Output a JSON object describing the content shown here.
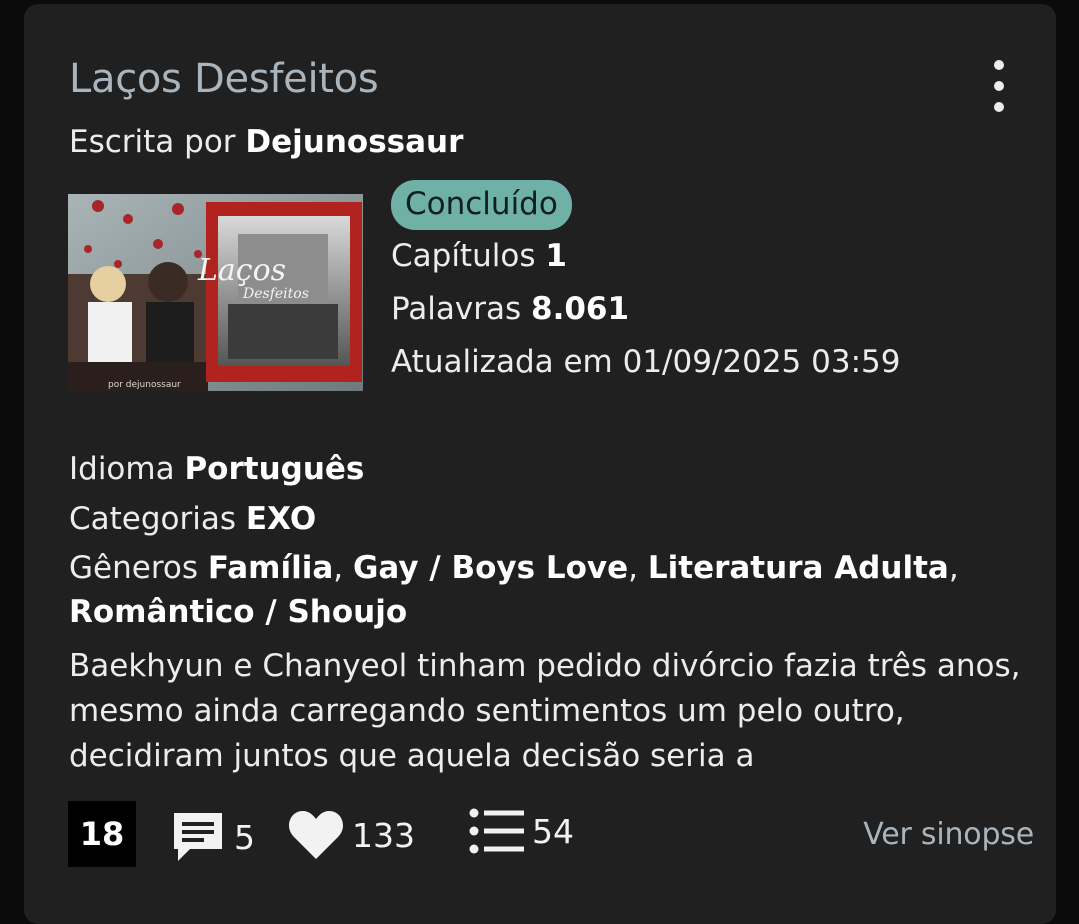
{
  "story": {
    "title": "Laços Desfeitos",
    "author_prefix": "Escrita por",
    "author": "Dejunossaur"
  },
  "cover": {
    "text_main": "Laços",
    "text_sub": "Desfeitos",
    "credit": "por dejunossaur"
  },
  "meta": {
    "status": "Concluído",
    "chapters_label": "Capítulos",
    "chapters": "1",
    "words_label": "Palavras",
    "words": "8.061",
    "updated": "Atualizada em 01/09/2025 03:59"
  },
  "info": {
    "language_label": "Idioma",
    "language": "Português",
    "categories_label": "Categorias",
    "categories": "EXO",
    "genres_label": "Gêneros",
    "genres": [
      "Família",
      "Gay / Boys Love",
      "Literatura Adulta",
      "Romântico / Shoujo"
    ]
  },
  "synopsis": "Baekhyun e Chanyeol tinham pedido divórcio fazia três anos, mesmo ainda carregando sentimentos um pelo outro, decidiram juntos que aquela decisão seria a",
  "footer": {
    "rating": "18",
    "comments": "5",
    "favorites": "133",
    "lists": "54",
    "synopsis_link": "Ver sinopse"
  },
  "icons": {
    "menu": "kebab-menu-icon",
    "comments": "comment-icon",
    "favorites": "heart-icon",
    "lists": "list-icon"
  },
  "colors": {
    "card": "#202020",
    "title": "#aab4bd",
    "badge": "#6fb1a6",
    "link": "#aab4bd"
  }
}
